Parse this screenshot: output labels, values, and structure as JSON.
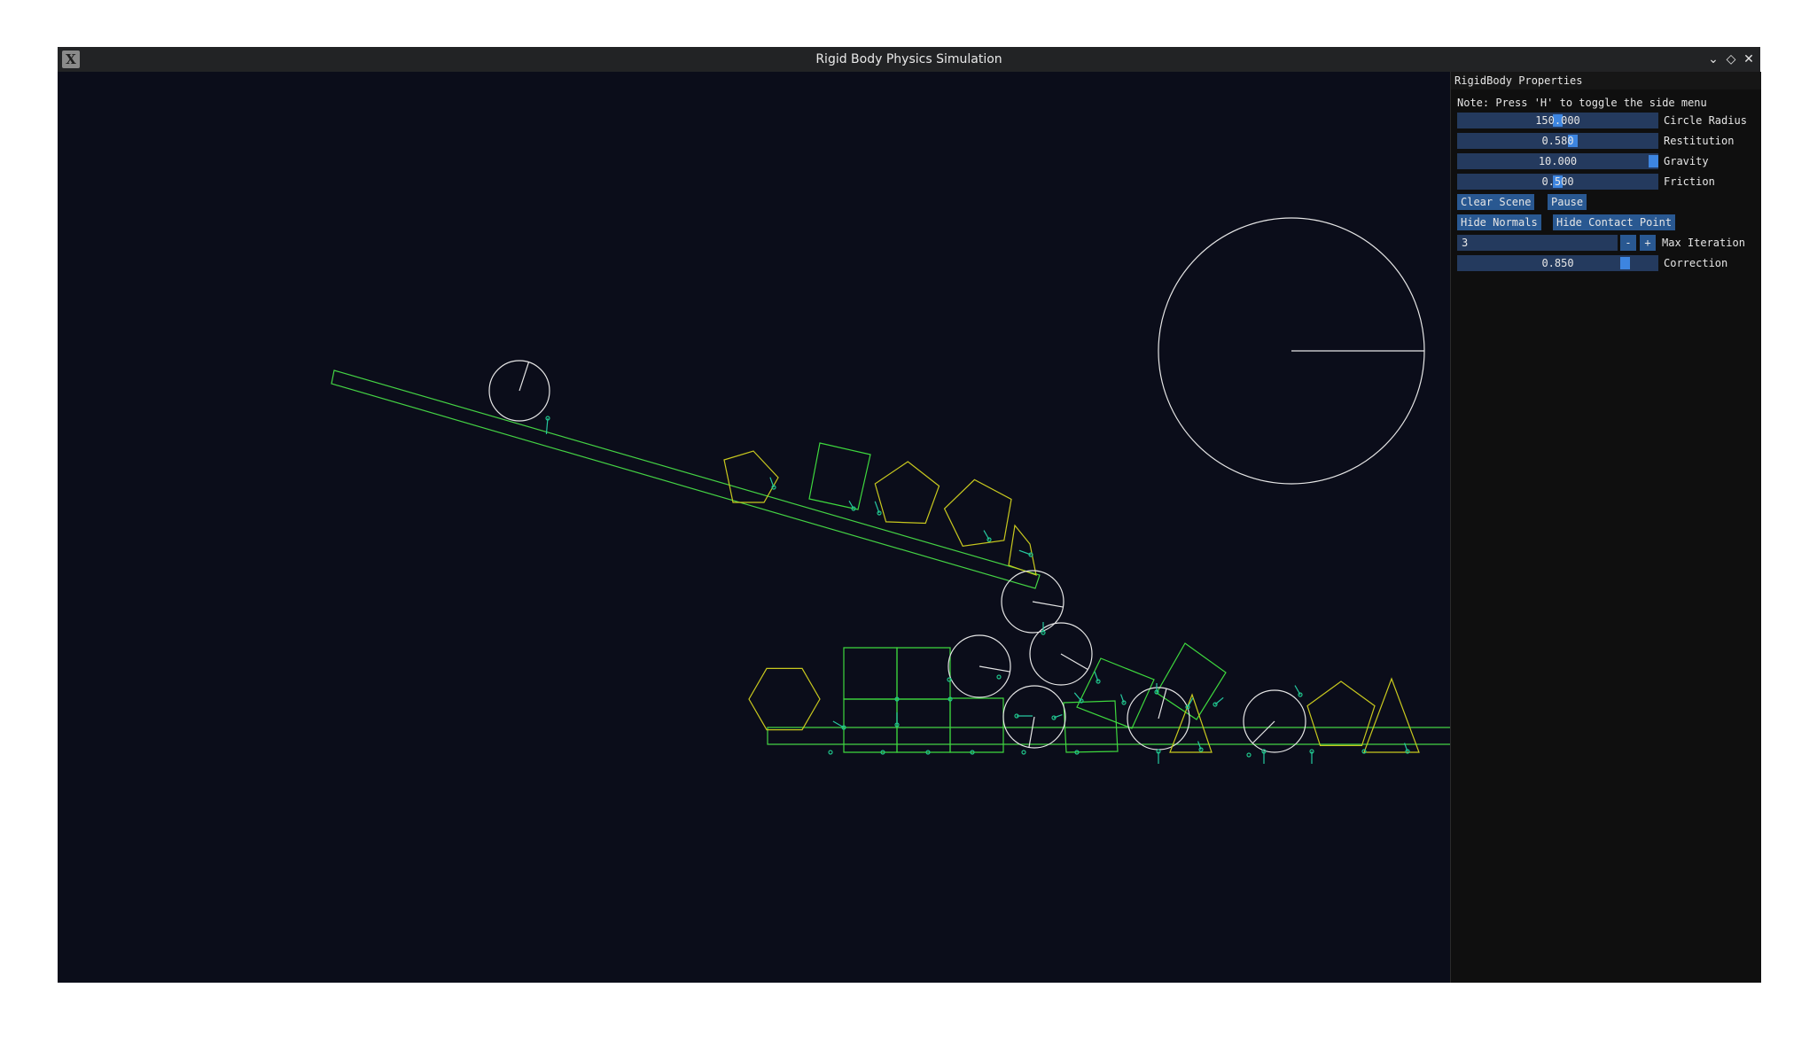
{
  "window": {
    "title": "Rigid Body Physics Simulation",
    "app_icon_glyph": "X",
    "controls": [
      "chevron-down-icon",
      "diamond-icon",
      "close-icon"
    ]
  },
  "panel": {
    "title": "RigidBody Properties",
    "note": "Note: Press 'H' to toggle the side menu",
    "sliders": [
      {
        "label": "Circle Radius",
        "value": "150.000",
        "fraction": 0.5
      },
      {
        "label": "Restitution",
        "value": "0.580",
        "fraction": 0.58
      },
      {
        "label": "Gravity",
        "value": "10.000",
        "fraction": 1.0
      },
      {
        "label": "Friction",
        "value": "0.500",
        "fraction": 0.5
      }
    ],
    "buttons": {
      "clear_scene": "Clear Scene",
      "pause": "Pause",
      "hide_normals": "Hide Normals",
      "hide_contact_point": "Hide Contact Point"
    },
    "max_iteration": {
      "label": "Max Iteration",
      "value": "3",
      "minus": "-",
      "plus": "+"
    },
    "correction": {
      "label": "Correction",
      "value": "0.850",
      "fraction": 0.85
    }
  },
  "scene": {
    "colors": {
      "background": "#0b0d1a",
      "static_body": "#44d244",
      "polygon": "#c8c81e",
      "box": "#3ed83e",
      "circle": "#e6e6e6",
      "normal": "#26c9a0",
      "contact_point": "#1fc48a"
    }
  }
}
